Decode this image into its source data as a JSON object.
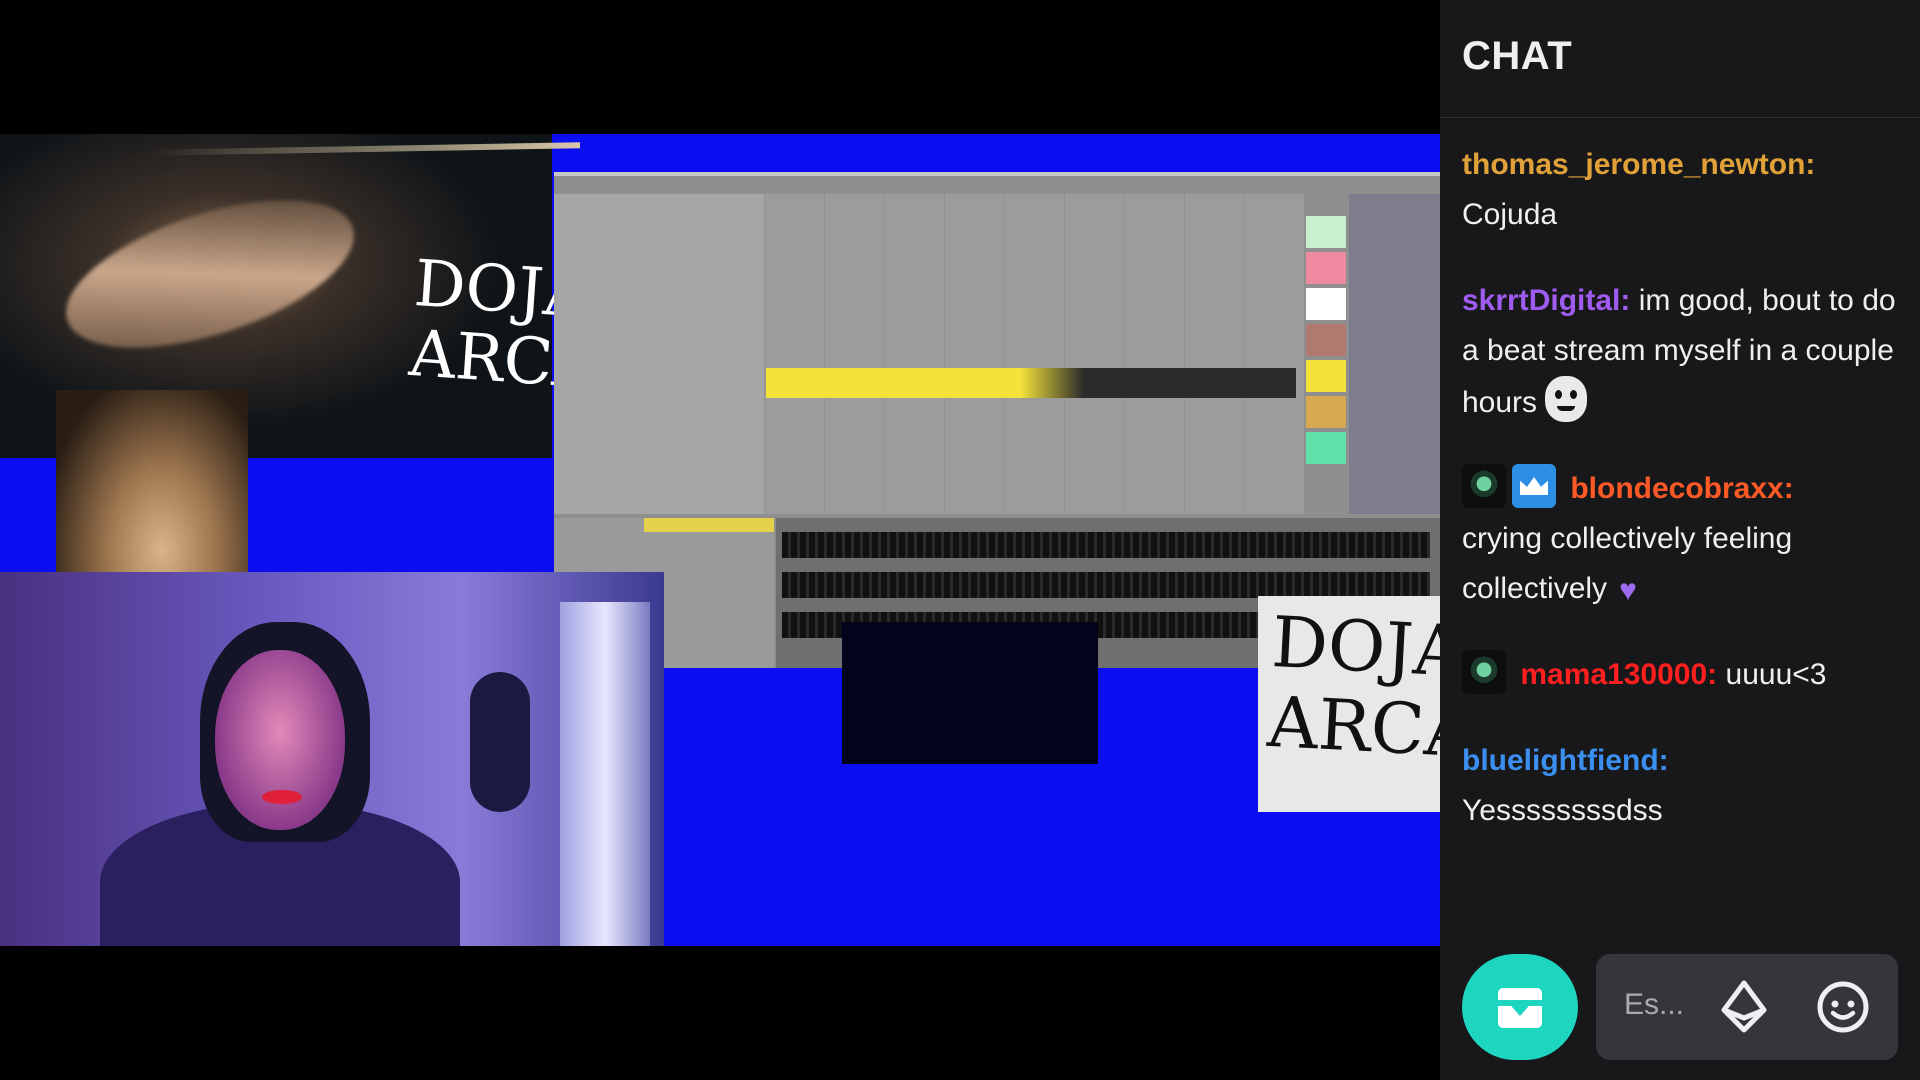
{
  "chat": {
    "title": "CHAT",
    "messages": [
      {
        "user": "thomas_jerome_newton:",
        "color": "#e0a238",
        "text": "Cojuda",
        "badges": []
      },
      {
        "user": "skrrtDigital:",
        "color": "#a05cf0",
        "text": "im good, bout to do a beat stream myself in a couple hours",
        "badges": [],
        "emote": "face-emote"
      },
      {
        "user": "blondecobraxx:",
        "color": "#ff5a26",
        "text": "crying collectively feeling collectively",
        "badges": [
          "mask-badge",
          "crown-badge"
        ],
        "emote": "purple-heart-emote"
      },
      {
        "user": "mama130000:",
        "color": "#ff1f1f",
        "text": "uuuu<3",
        "badges": [
          "mask-badge"
        ]
      },
      {
        "user": "bluelightfiend:",
        "color": "#3b8ff0",
        "text": "Yessssssssdss",
        "badges": []
      }
    ],
    "input": {
      "placeholder": "Es..."
    },
    "icons": {
      "send": "inbox-tray-icon",
      "bits": "bits-diamond-icon",
      "emote": "smiley-icon"
    },
    "accent": "#1ed6c0"
  },
  "stream": {
    "art_text_top": "DOJA\nARCA",
    "art_text_bottom": "DOJA\nARCA"
  }
}
